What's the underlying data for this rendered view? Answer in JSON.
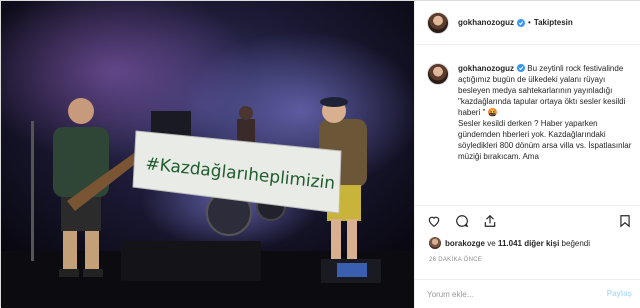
{
  "post": {
    "username": "gokhanozoguz",
    "separator": "•",
    "follow_label": "Takiptesin",
    "caption": "Bu zeytinli rock festivalinde açtığımız bugün de ülkedeki yalanı rüyayı besleyen medya sahtekarlarının yayınladığı \"kazdağlarında tapular ortaya öktı sesler kesildi haberi \" 🤬\nSesler kesildi derken ? Haber yaparken gündemden hberleri yok. Kazdağlarındaki söyledikleri 800 dönüm arsa villa vs. İspatlasınlar müziği bırakıcam. Ama",
    "banner_text": "#Kazdağlarıheplimizin",
    "likes_user": "borakozge",
    "likes_connector": "ve",
    "likes_count": "11.041 diğer kişi",
    "likes_suffix": "beğendi",
    "timestamp": "26 DAKİKA ÖNCE",
    "comment_placeholder": "Yorum ekle...",
    "post_button": "Paylaş"
  },
  "icons": {
    "verified": "verified-badge-icon",
    "like": "heart-icon",
    "comment": "comment-icon",
    "share": "share-icon",
    "save": "bookmark-icon"
  },
  "colors": {
    "verified": "#3897f0",
    "post_button_disabled": "#b2dffc"
  }
}
